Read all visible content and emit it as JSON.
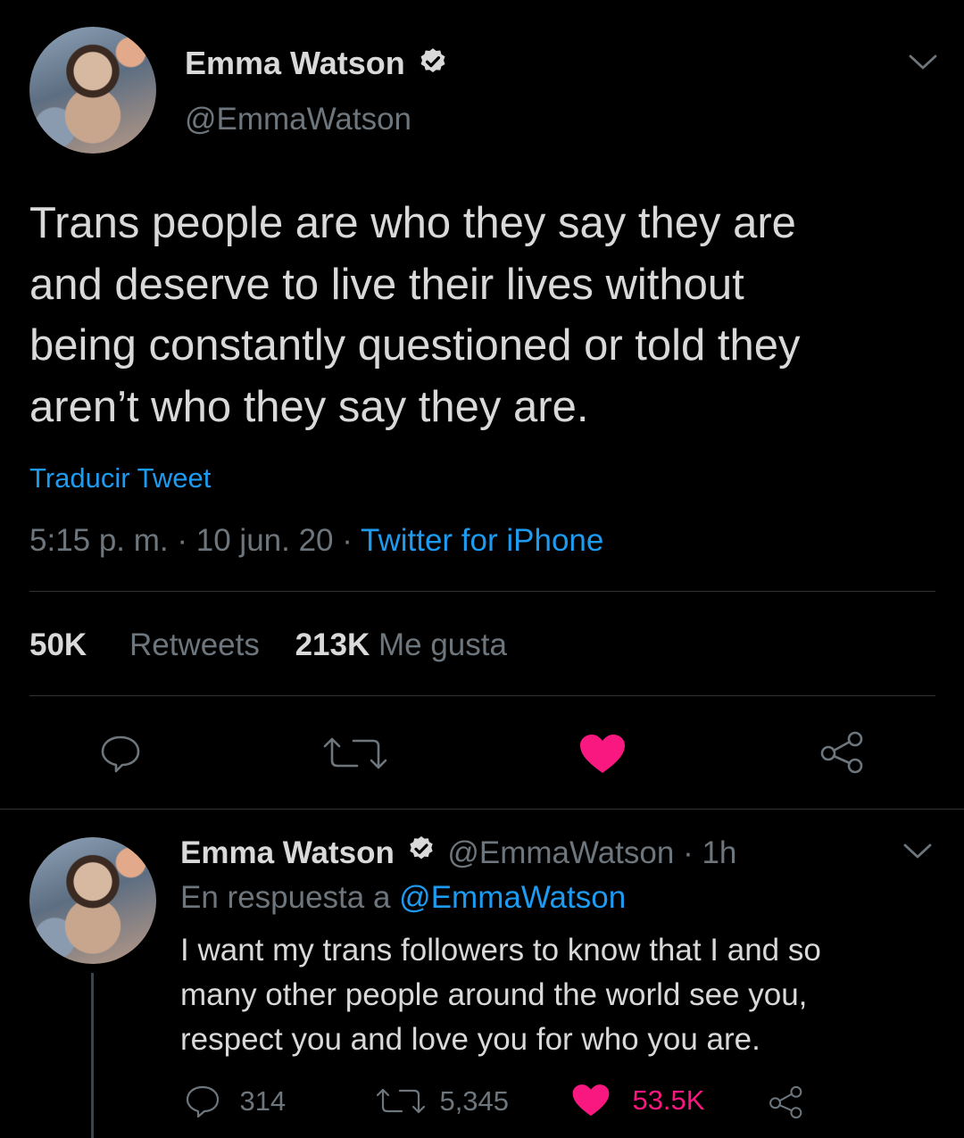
{
  "main_tweet": {
    "author_name": "Emma Watson",
    "handle": "@EmmaWatson",
    "text_lines": [
      "Trans people are who they say they are",
      "and deserve to live their lives without",
      "being constantly questioned or told they",
      "aren’t who they say they are."
    ],
    "translate_label": "Traducir Tweet",
    "time": "5:15 p. m.",
    "date": "10 jun. 20",
    "source": "Twitter for iPhone",
    "retweets_count": "50K",
    "retweets_label": "Retweets",
    "likes_count": "213K",
    "likes_label": "Me gusta"
  },
  "reply_tweet": {
    "author_name": "Emma Watson",
    "handle": "@EmmaWatson",
    "age": "1h",
    "reply_prefix": "En respuesta a",
    "reply_to": "@EmmaWatson",
    "text_lines": [
      "I want my trans followers to know that I and so",
      "many other people around the world see you,",
      "respect you and love you for who you are."
    ],
    "replies_count": "314",
    "retweets_count": "5,345",
    "likes_count": "53.5K"
  },
  "colors": {
    "background": "#000000",
    "text": "#d9d9d9",
    "muted": "#6e767d",
    "link": "#1d9bf0",
    "like": "#f91880"
  },
  "icons": [
    "chevron-down-icon",
    "verified-badge-icon",
    "reply-icon",
    "retweet-icon",
    "heart-icon",
    "share-icon"
  ]
}
